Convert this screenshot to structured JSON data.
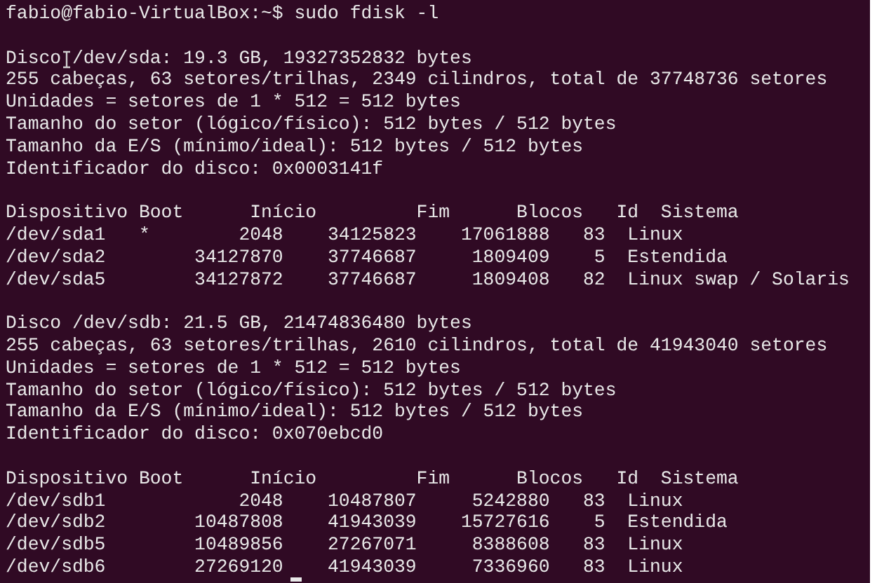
{
  "terminal": {
    "blocks": [
      {
        "lines": [
          "fabio@fabio-VirtualBox:~$ sudo fdisk -l"
        ]
      },
      {
        "lines": [
          {
            "label": "Disco",
            "value": "/dev/sda: 19.3 GB, 19327352832 bytes"
          },
          "255 cabeças, 63 setores/trilhas, 2349 cilindros, total de 37748736 setores",
          "Unidades = setores de 1 * 512 = 512 bytes",
          "Tamanho do setor (lógico/físico): 512 bytes / 512 bytes",
          "Tamanho da E/S (mínimo/ideal): 512 bytes / 512 bytes",
          "Identificador do disco: 0x0003141f"
        ]
      },
      {
        "lines": [
          "Dispositivo Boot      Início         Fim      Blocos   Id  Sistema",
          "/dev/sda1   *        2048    34125823    17061888   83  Linux",
          "/dev/sda2        34127870    37746687     1809409    5  Estendida",
          "/dev/sda5        34127872    37746687     1809408   82  Linux swap / Solaris"
        ]
      },
      {
        "lines": [
          {
            "label": "Disco",
            "value": "/dev/sdb: 21.5 GB, 21474836480 bytes"
          },
          "255 cabeças, 63 setores/trilhas, 2610 cilindros, total de 41943040 setores",
          "Unidades = setores de 1 * 512 = 512 bytes",
          "Tamanho do setor (lógico/físico): 512 bytes / 512 bytes",
          "Tamanho da E/S (mínimo/ideal): 512 bytes / 512 bytes",
          "Identificador do disco: 0x070ebcd0"
        ]
      },
      {
        "lines": [
          "Dispositivo Boot      Início         Fim      Blocos   Id  Sistema",
          "/dev/sdb1            2048    10487807     5242880   83  Linux",
          "/dev/sdb2        10487808    41943039    15727616    5  Estendida",
          "/dev/sdb5        10489856    27267071     8388608   83  Linux",
          "/dev/sdb6        27269120    41943039     7336960   83  Linux"
        ]
      }
    ]
  }
}
